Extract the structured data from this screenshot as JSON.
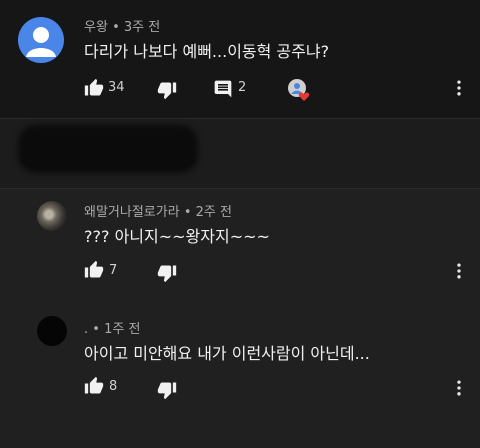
{
  "comments": [
    {
      "author": "우왕",
      "sep": "•",
      "time": "3주 전",
      "text": "다리가 나보다 예뻐...이동혁 공주냐?",
      "likes": "34",
      "replies": "2"
    },
    {
      "author": "왜말거나절로가라",
      "sep": "•",
      "time": "2주 전",
      "text": "??? 아니지~~왕자지~~~",
      "likes": "7"
    },
    {
      "author": ".",
      "sep": "•",
      "time": "1주 전",
      "text": "아이고 미안해요 내가 이런사람이 아닌데...",
      "likes": "8"
    }
  ],
  "colors": {
    "background": "#1c1c1c",
    "avatar_blue": "#4a86e8",
    "heart_red": "#e53935",
    "text": "#f1f1f1",
    "meta": "#aaaaaa"
  },
  "icons": [
    "thumb-up-icon",
    "thumb-down-icon",
    "comment-icon",
    "creator-heart-icon",
    "more-vert-icon",
    "default-avatar-icon"
  ]
}
